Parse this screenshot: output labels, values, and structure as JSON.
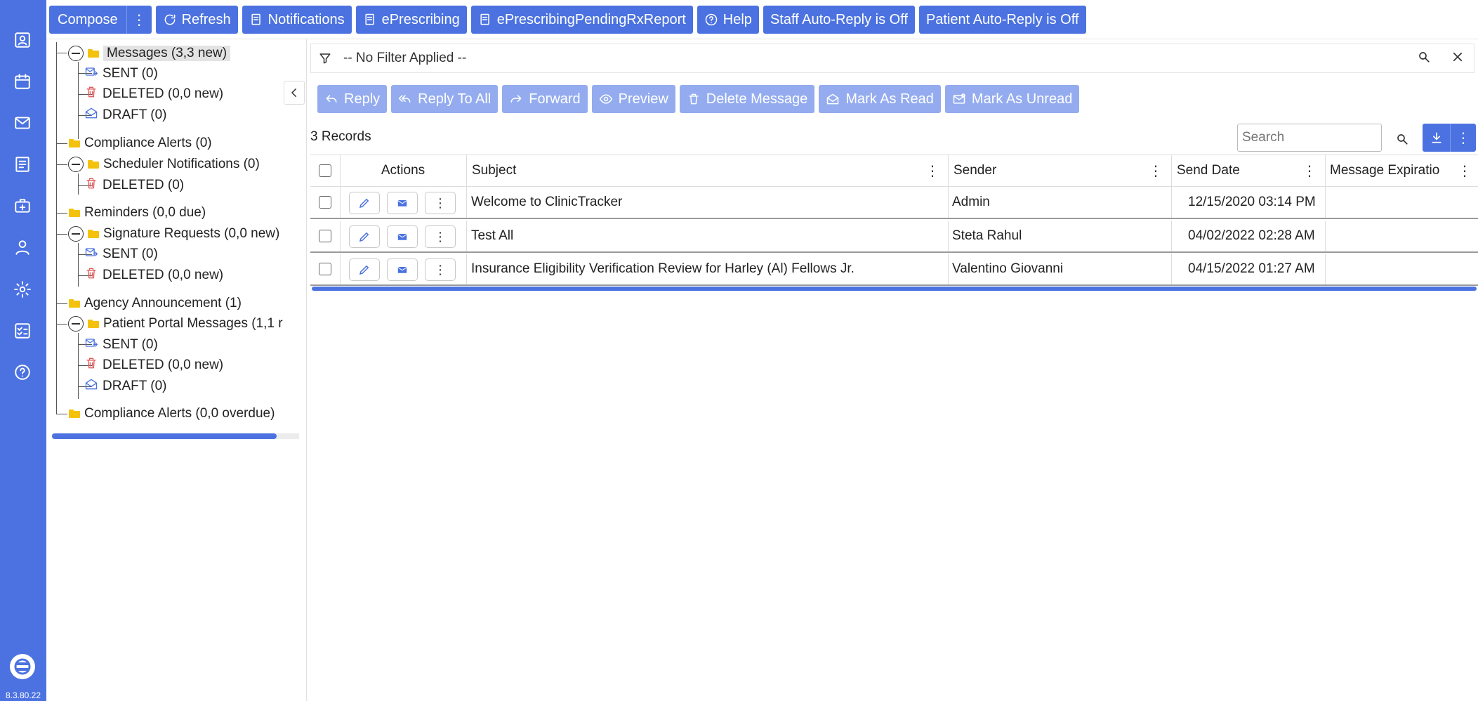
{
  "toolbar": {
    "compose": "Compose",
    "refresh": "Refresh",
    "notifications": "Notifications",
    "eprescribing": "ePrescribing",
    "eprescribing_pending": "ePrescribingPendingRxReport",
    "help": "Help",
    "staff_auto_reply": "Staff Auto-Reply is Off",
    "patient_auto_reply": "Patient Auto-Reply is Off"
  },
  "rail": {
    "icons": [
      "dashboard-icon",
      "calendar-icon",
      "mail-icon",
      "clipboard-icon",
      "medical-kit-icon",
      "person-icon",
      "settings-icon",
      "checklist-icon",
      "help-icon"
    ],
    "version": "8.3.80.22"
  },
  "tree": {
    "messages": "Messages (3,3 new)",
    "messages_sent": "SENT (0)",
    "messages_deleted": "DELETED (0,0 new)",
    "messages_draft": "DRAFT (0)",
    "compliance_alerts": "Compliance Alerts (0)",
    "scheduler": "Scheduler Notifications (0)",
    "scheduler_deleted": "DELETED (0)",
    "reminders": "Reminders (0,0 due)",
    "signature": "Signature Requests (0,0 new)",
    "signature_sent": "SENT (0)",
    "signature_deleted": "DELETED (0,0 new)",
    "agency": "Agency Announcement (1)",
    "portal": "Patient Portal Messages (1,1 r",
    "portal_sent": "SENT (0)",
    "portal_deleted": "DELETED (0,0 new)",
    "portal_draft": "DRAFT (0)",
    "compliance_overdue": "Compliance Alerts (0,0 overdue)"
  },
  "filter": {
    "text": "-- No Filter Applied --"
  },
  "actions": {
    "reply": "Reply",
    "reply_all": "Reply To All",
    "forward": "Forward",
    "preview": "Preview",
    "delete": "Delete Message",
    "mark_read": "Mark As Read",
    "mark_unread": "Mark As Unread"
  },
  "records": "3 Records",
  "search": {
    "placeholder": "Search"
  },
  "grid": {
    "headers": {
      "actions": "Actions",
      "subject": "Subject",
      "sender": "Sender",
      "send_date": "Send Date",
      "expiration": "Message Expiratio"
    },
    "rows": [
      {
        "subject": "Welcome to ClinicTracker",
        "sender": "Admin",
        "send_date": "12/15/2020 03:14 PM"
      },
      {
        "subject": "Test All",
        "sender": "Steta Rahul",
        "send_date": "04/02/2022 02:28 AM"
      },
      {
        "subject": "Insurance Eligibility Verification Review for Harley (Al) Fellows Jr.",
        "sender": "Valentino Giovanni",
        "send_date": "04/15/2022 01:27 AM"
      }
    ]
  },
  "colors": {
    "primary": "#4b72e0",
    "primary_light": "#94acef",
    "folder": "#f4c20d",
    "delete": "#e05a5a"
  }
}
